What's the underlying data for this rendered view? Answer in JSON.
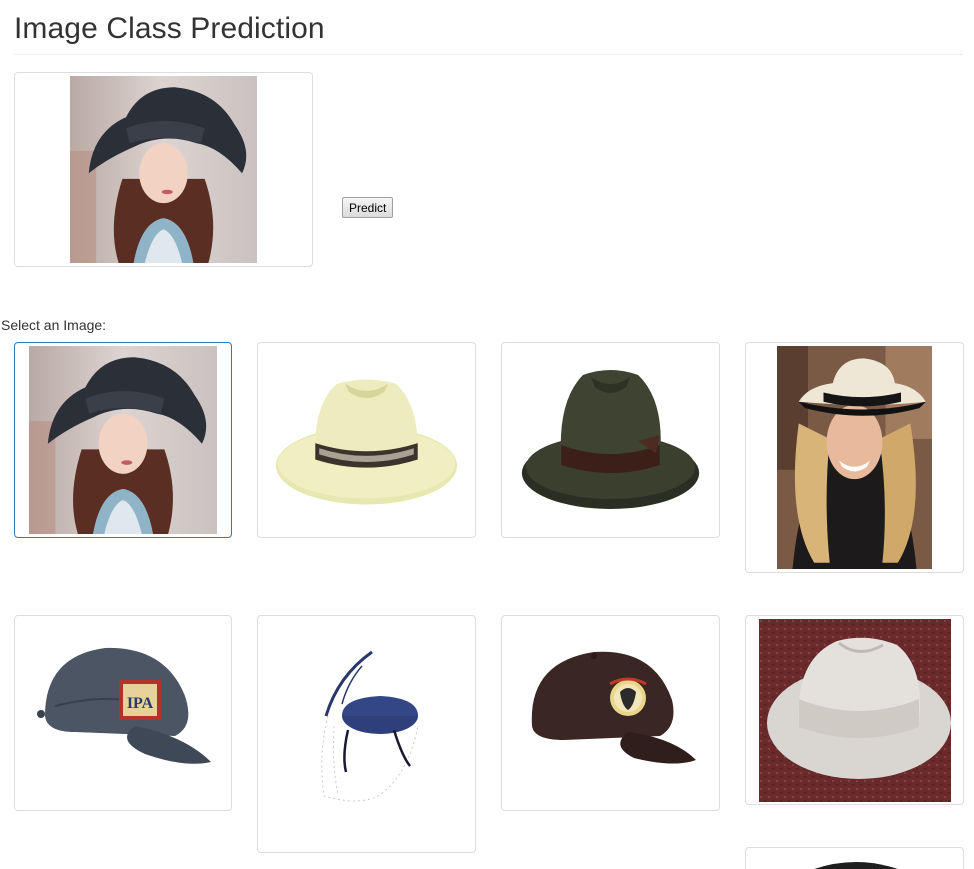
{
  "page": {
    "title": "Image Class Prediction"
  },
  "preview": {
    "image_name": "woman-wide-brim-black-hat"
  },
  "predict": {
    "label": "Predict"
  },
  "gallery": {
    "label": "Select an Image:",
    "selected_index": 0,
    "items": [
      {
        "name": "woman-wide-brim-black-hat",
        "selected": true
      },
      {
        "name": "cream-fedora-patterned-band"
      },
      {
        "name": "dark-green-fedora"
      },
      {
        "name": "blonde-woman-panama-hat"
      },
      {
        "name": "gray-ipa-baseball-cap"
      },
      {
        "name": "navy-fascinator-veil"
      },
      {
        "name": "brown-baseball-cap-badge"
      },
      {
        "name": "white-straw-panama-hat"
      },
      {
        "name": "black-hat-partial"
      }
    ]
  },
  "colors": {
    "selected_border": "#337ab7",
    "thumb_border": "#dddddd",
    "title_text": "#333333"
  }
}
